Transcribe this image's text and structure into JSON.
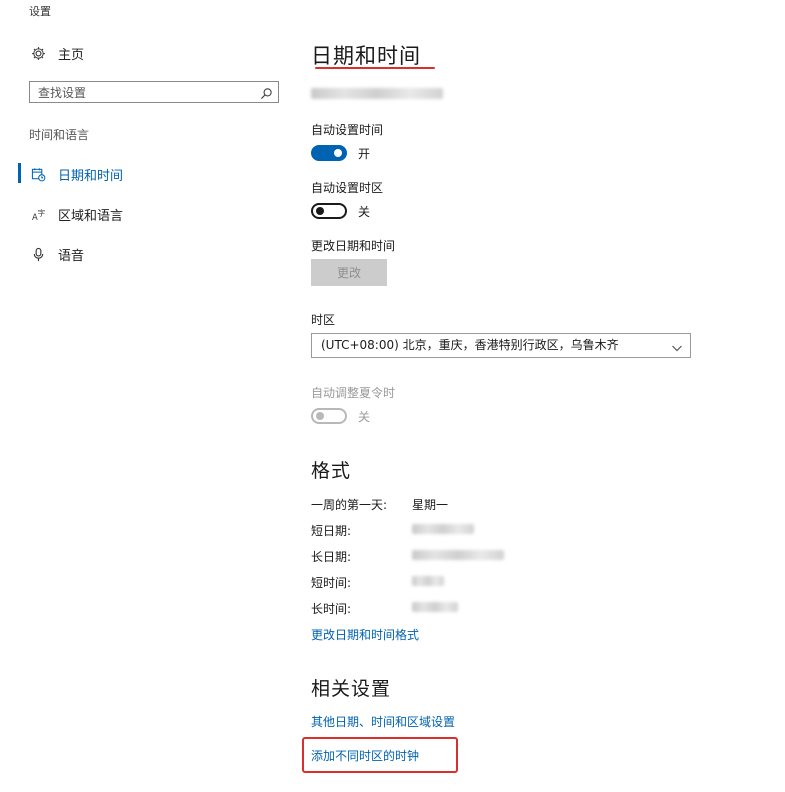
{
  "window": {
    "title": "设置"
  },
  "sidebar": {
    "home_label": "主页",
    "search_placeholder": "查找设置",
    "section_label": "时间和语言",
    "items": [
      {
        "label": "日期和时间",
        "icon": "calendar-clock-icon",
        "active": true
      },
      {
        "label": "区域和语言",
        "icon": "language-icon",
        "active": false
      },
      {
        "label": "语音",
        "icon": "microphone-icon",
        "active": false
      }
    ]
  },
  "main": {
    "title": "日期和时间",
    "auto_time": {
      "label": "自动设置时间",
      "state": "开",
      "on": true
    },
    "auto_timezone": {
      "label": "自动设置时区",
      "state": "关",
      "on": false
    },
    "change_datetime": {
      "label": "更改日期和时间",
      "button": "更改",
      "enabled": false
    },
    "timezone": {
      "label": "时区",
      "value": "(UTC+08:00) 北京，重庆，香港特别行政区，乌鲁木齐"
    },
    "dst": {
      "label": "自动调整夏令时",
      "state": "关",
      "enabled": false
    },
    "formats": {
      "heading": "格式",
      "rows": [
        {
          "key": "一周的第一天:",
          "value": "星期一"
        },
        {
          "key": "短日期:",
          "value": ""
        },
        {
          "key": "长日期:",
          "value": ""
        },
        {
          "key": "短时间:",
          "value": ""
        },
        {
          "key": "长时间:",
          "value": ""
        }
      ],
      "link": "更改日期和时间格式"
    },
    "related": {
      "heading": "相关设置",
      "links": [
        "其他日期、时间和区域设置",
        "添加不同时区的时钟"
      ]
    }
  },
  "colors": {
    "accent": "#0063b1",
    "annotation": "#d9302c"
  }
}
